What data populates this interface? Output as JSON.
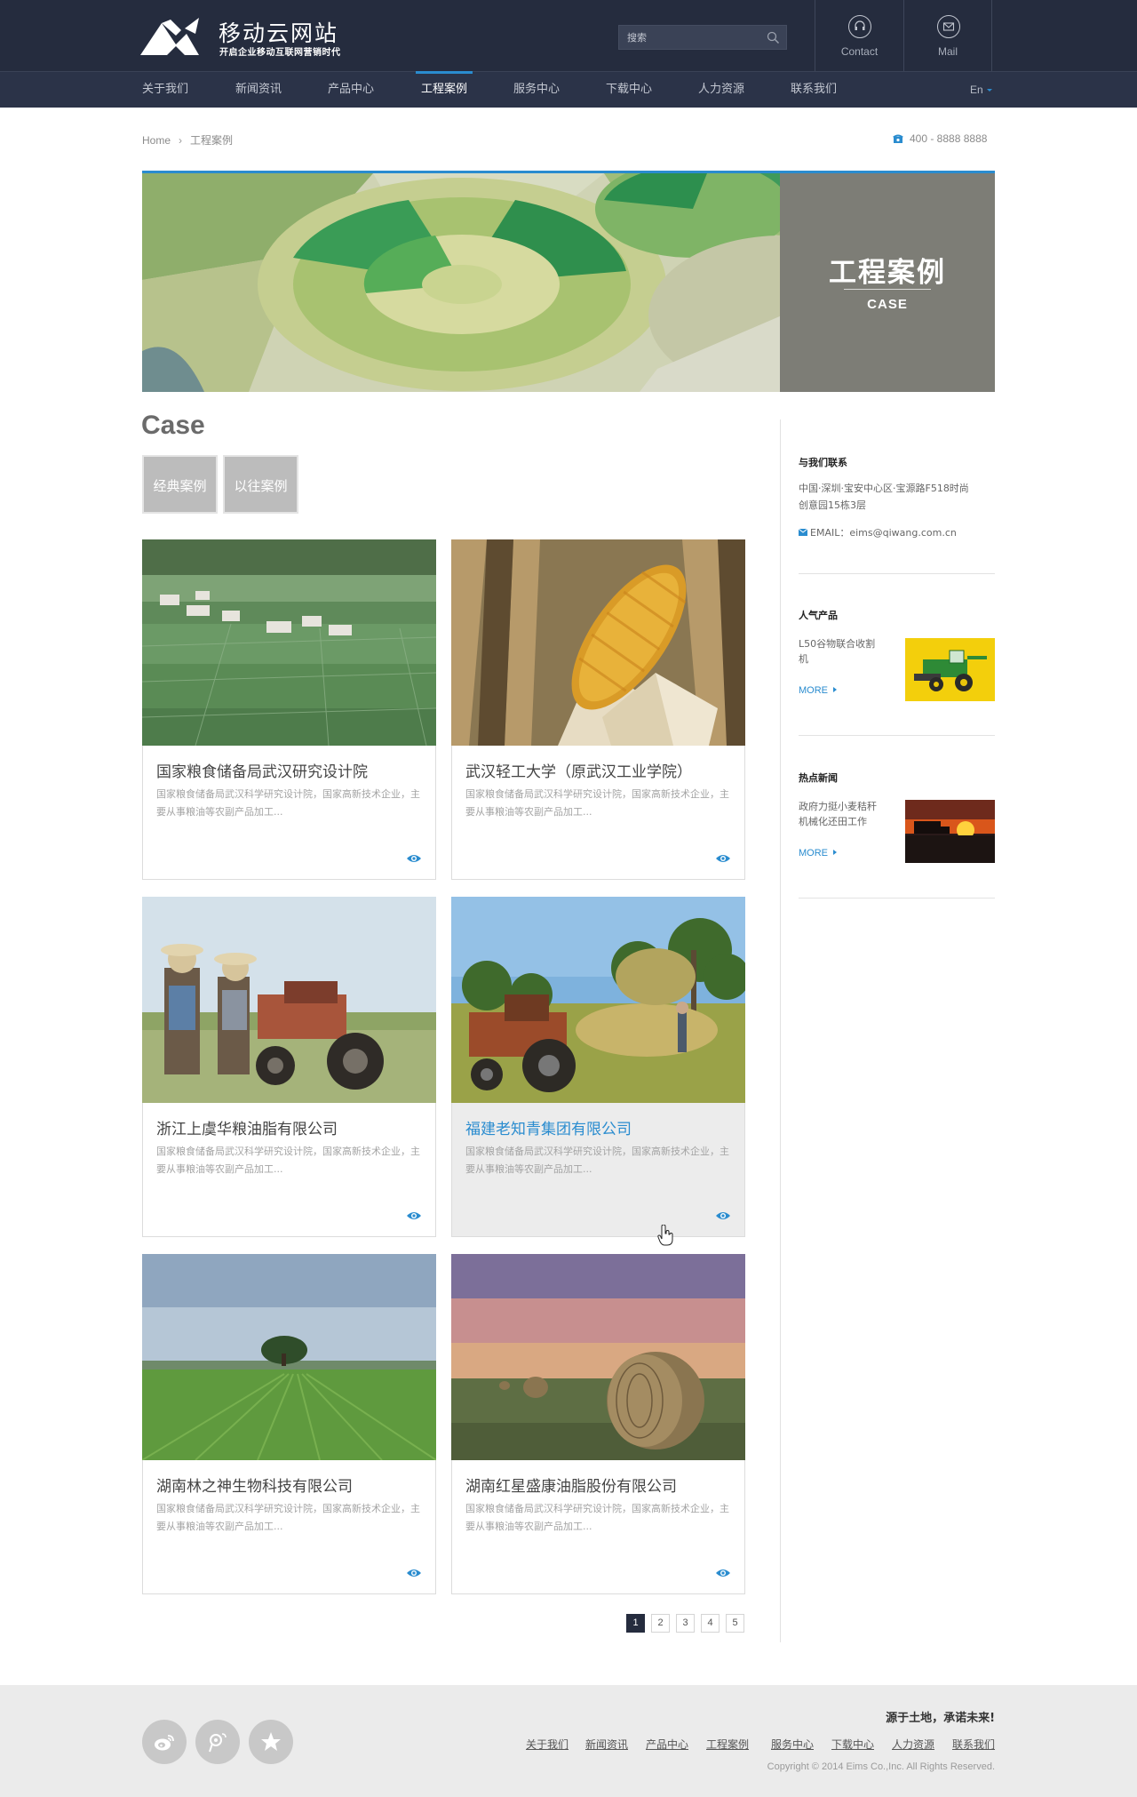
{
  "header": {
    "site_name": "移动云网站",
    "slogan": "开启企业移动互联网营销时代",
    "search_placeholder": "搜索",
    "contact_label": "Contact",
    "mail_label": "Mail"
  },
  "nav": {
    "items": [
      "关于我们",
      "新闻资讯",
      "产品中心",
      "工程案例",
      "服务中心",
      "下载中心",
      "人力资源",
      "联系我们"
    ],
    "active": "工程案例",
    "lang": "En"
  },
  "breadcrumb": {
    "home": "Home",
    "current": "工程案例"
  },
  "phone": "400 - 8888 8888",
  "banner": {
    "title": "工程案例",
    "subtitle": "CASE"
  },
  "main": {
    "title": "Case",
    "tabs": [
      "经典案例",
      "以往案例"
    ],
    "cards": [
      {
        "title": "国家粮食储备局武汉研究设计院",
        "desc": "国家粮食储备局武汉科学研究设计院，国家高新技术企业，主要从事粮油等农副产品加工..."
      },
      {
        "title": "武汉轻工大学（原武汉工业学院）",
        "desc": "国家粮食储备局武汉科学研究设计院，国家高新技术企业，主要从事粮油等农副产品加工..."
      },
      {
        "title": "浙江上虞华粮油脂有限公司",
        "desc": "国家粮食储备局武汉科学研究设计院，国家高新技术企业，主要从事粮油等农副产品加工..."
      },
      {
        "title": "福建老知青集团有限公司",
        "desc": "国家粮食储备局武汉科学研究设计院，国家高新技术企业，主要从事粮油等农副产品加工..."
      },
      {
        "title": "湖南林之神生物科技有限公司",
        "desc": "国家粮食储备局武汉科学研究设计院，国家高新技术企业，主要从事粮油等农副产品加工..."
      },
      {
        "title": "湖南红星盛康油脂股份有限公司",
        "desc": "国家粮食储备局武汉科学研究设计院，国家高新技术企业，主要从事粮油等农副产品加工..."
      }
    ],
    "pages": [
      "1",
      "2",
      "3",
      "4",
      "5"
    ],
    "current_page": "1"
  },
  "sidebar": {
    "contact": {
      "heading": "与我们联系",
      "address_line1": "中国·深圳·宝安中心区·宝源路F518时尚",
      "address_line2": "创意园15栋3层",
      "email": "EMAIL：eims@qiwang.com.cn"
    },
    "product": {
      "heading": "人气产品",
      "name_line1": "L50谷物联合收割",
      "name_line2": "机",
      "more": "MORE"
    },
    "news": {
      "heading": "热点新闻",
      "title_line1": "政府力挺小麦秸秆",
      "title_line2": "机械化还田工作",
      "more": "MORE"
    }
  },
  "footer": {
    "slogan": "源于土地，承诺未来!",
    "links": [
      "关于我们",
      "新闻资讯",
      "产品中心",
      "工程案例",
      "服务中心",
      "下载中心",
      "人力资源",
      "联系我们"
    ],
    "copyright": "Copyright © 2014  Eims Co.,Inc. All Rights Reserved."
  },
  "colors": {
    "header_bg": "#252c3e",
    "nav_bg": "#2b3348",
    "accent": "#2a8ccf",
    "footer_bg": "#ebebeb"
  },
  "icons": [
    "search-icon",
    "headset-icon",
    "mail-icon",
    "phone-icon",
    "eye-icon",
    "weibo-icon",
    "qq-weibo-icon",
    "star-icon"
  ]
}
